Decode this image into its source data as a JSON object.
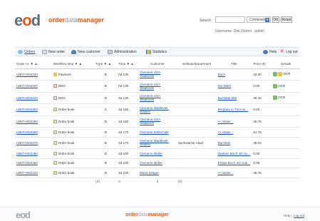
{
  "header": {
    "logo_prefix": "e",
    "logo_mid": "o",
    "logo_suffix": "d",
    "app_name_a": "order",
    "app_name_b": "data",
    "app_name_c": "manager",
    "search_label": "Search:",
    "search_value": "",
    "search_select": "Combined",
    "ok_label": "OK",
    "reset_label": "Reset",
    "username": "Username: Dirk Ostreri , admin"
  },
  "nav": {
    "orders": "Orders",
    "new_order": "New order",
    "new_customer": "New customer",
    "administration": "Administration",
    "statistics": "Statistics",
    "help": "Help",
    "logout": "Log out"
  },
  "table": {
    "headers": [
      "Order nr. ▼ ▲",
      "Workflow step ▼ ▲",
      "Type ▼ ▲",
      "Time ▼ ▲",
      "Customer",
      "Institute/department",
      "Title",
      "Price (€)",
      "Details"
    ],
    "rows": [
      {
        "order": "UB07A004330",
        "wf": "Payment",
        "type": "D",
        "time": "0d 13h",
        "cust1": "Clemens-USA",
        "cust2": "Wadlevek",
        "inst": "",
        "title": "Buch",
        "price": "19.00",
        "details": "OCR"
      },
      {
        "order": "UB07A004320",
        "wf": "DDG",
        "type": "D",
        "time": "0d 13h",
        "cust1": "Clemens-USA",
        "cust2": "Wadlevek",
        "inst": "",
        "title": "Die Bibel",
        "price": "0.00",
        "details": "OCR"
      },
      {
        "order": "UB07A004310",
        "wf": "DDG",
        "type": "D",
        "time": "2d 13h",
        "cust1": "Clemens-USA",
        "cust2": "Wadlevek",
        "inst": "",
        "title": "Buchtitel 666",
        "price": "35.15",
        "details": "OCR"
      },
      {
        "order": "UB07A004300",
        "wf": "Order book",
        "type": "C",
        "time": "2d 16h",
        "cust1": "Clemens Wadlevek,",
        "cust2": "Wadlev",
        "inst": "",
        "title": "Bergbau in Tirol un...",
        "price": "0.00",
        "details": ""
      },
      {
        "order": "UB07A004290",
        "wf": "Order book",
        "type": "D",
        "time": "2d 16h",
        "cust1": "Clemens-USA",
        "cust2": "Wadlevek",
        "inst": "",
        "title": "<< Maler...",
        "price": "46.76",
        "details": ""
      },
      {
        "order": "UB07A004280",
        "wf": "Order book",
        "type": "D",
        "time": "2d 17h",
        "cust1": "Clemens Softschalk",
        "cust2": "",
        "inst": "",
        "title": "<< Maler...",
        "price": "51.76",
        "details": ""
      },
      {
        "order": "UB07A004270",
        "wf": "Order book",
        "type": "D",
        "time": "2d 17h",
        "cust1": "Clemens Wadlevek,",
        "cust2": "Wadlev",
        "inst": "Sachwache Akad",
        "title": "Buchtitel",
        "price": "38.04",
        "details": ""
      },
      {
        "order": "UB07A004260",
        "wf": "Order book",
        "type": "D",
        "time": "2d 18h",
        "cust1": "Clemens Müller",
        "cust2": "",
        "inst": "",
        "title": "Zweites Buch mit Su...",
        "price": "0.00",
        "details": ""
      },
      {
        "order": "UB07A004250",
        "wf": "Order book",
        "type": "D",
        "time": "2d 18h",
        "cust1": "Clemens Müller",
        "cust2": "",
        "inst": "",
        "title": "Erstes Buch mit Sub...",
        "price": "0.00",
        "details": ""
      },
      {
        "order": "UB07A004220",
        "wf": "Order book",
        "type": "D",
        "time": "4d 22h",
        "cust1": "Maria Dräger",
        "cust2": "",
        "inst": "",
        "title": "<< Maler...",
        "price": "46.76",
        "details": ""
      }
    ],
    "summary": {
      "a": "(0)",
      "b": "0",
      "c": "0",
      "d": "(0)"
    }
  },
  "footer": {
    "logo": "eod",
    "app_a": "order",
    "app_b": "data",
    "app_c": "manager",
    "help": "Help |",
    "logout": "Log out"
  },
  "colors": {
    "brand_orange": "#e05a1a",
    "brand_slate": "#5a6f86",
    "link_blue": "#1a56a8"
  }
}
